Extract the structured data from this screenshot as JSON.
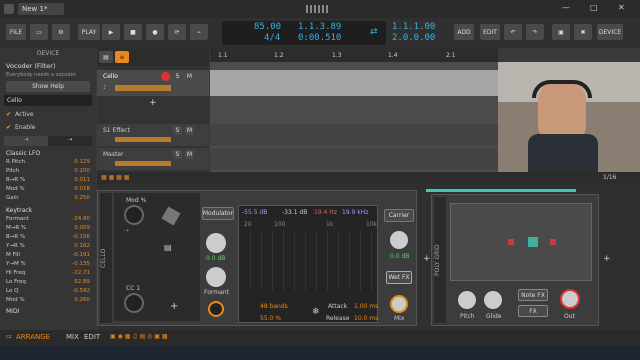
{
  "titlebar": {
    "tab": "New 1*",
    "minimize": "—",
    "maximize": "□",
    "close": "✕"
  },
  "toolbar": {
    "file": "FILE",
    "play": "PLAY",
    "bpm": "85.00",
    "sig": "4/4",
    "pos1": "1.1.3.89",
    "pos2": "0:00.510",
    "loop1": "1.1.1.00",
    "loop2": "2.0.0.00",
    "add": "ADD",
    "edit": "EDIT",
    "device": "DEVICE"
  },
  "inspector": {
    "header": "DEVICE",
    "name": "Vocoder (Filter)",
    "desc": "Everybody needs a vocoder.",
    "help": "Show Help",
    "track": "Cello",
    "active": "Active",
    "enable": "Enable",
    "lfo": "Classic LFO",
    "keytrack": "Keytrack",
    "midi": "MIDI",
    "lfo_params": [
      {
        "n": "R Pitch",
        "v": "0.129"
      },
      {
        "n": "Pitch",
        "v": "0.200"
      },
      {
        "n": "B→R %",
        "v": "0.011"
      },
      {
        "n": "Mod %",
        "v": "0.018"
      },
      {
        "n": "Gain",
        "v": "0.250"
      }
    ],
    "key_params": [
      {
        "n": "Formant",
        "v": "-24.80"
      },
      {
        "n": "M→R %",
        "v": "0.009"
      },
      {
        "n": "B→R %",
        "v": "-0.156"
      },
      {
        "n": "Y→R %",
        "v": "0.162"
      },
      {
        "n": "M Fill",
        "v": "-0.191"
      },
      {
        "n": "Y→M %",
        "v": "-0.135"
      },
      {
        "n": "Hi Freq",
        "v": "-22.71"
      },
      {
        "n": "Lo Freq",
        "v": "52.89"
      },
      {
        "n": "Lo Q",
        "v": "-0.592"
      },
      {
        "n": "Mod %",
        "v": "0.260"
      }
    ]
  },
  "tracks": [
    {
      "name": "Cello"
    },
    {
      "name": "S1 Effect"
    },
    {
      "name": "Master"
    }
  ],
  "ruler": [
    "1.1",
    "1.2",
    "1.3",
    "1.4",
    "2.1"
  ],
  "zoom": "1/16",
  "device": {
    "track": "CELLO",
    "modpct": "Mod %",
    "cc": "CC 1",
    "modulator": "Modulator",
    "carrier": "Carrier",
    "db1": "0.0 dB",
    "db2": "0.0 dB",
    "formant": "Formant",
    "wetfx": "Wet FX",
    "mix": "Mix",
    "readout": {
      "a": "-55.5 dB",
      "b": "-33.1 dB",
      "c": "19.4 Hz",
      "d": "19.9 kHz"
    },
    "bands": "48 bands",
    "pct": "55.0 %",
    "attack": "Attack",
    "attack_v": "1.00 ms",
    "release": "Release",
    "release_v": "10.0 ms",
    "ticks": [
      "20",
      "100",
      "1k",
      "10k"
    ]
  },
  "poly": {
    "label": "POLY GRID",
    "pitch": "Pitch",
    "glide": "Glide",
    "notefx": "Note FX",
    "fx": "FX",
    "out": "Out"
  },
  "bottom": {
    "arrange": "ARRANGE",
    "mix": "MIX",
    "edit": "EDIT"
  }
}
